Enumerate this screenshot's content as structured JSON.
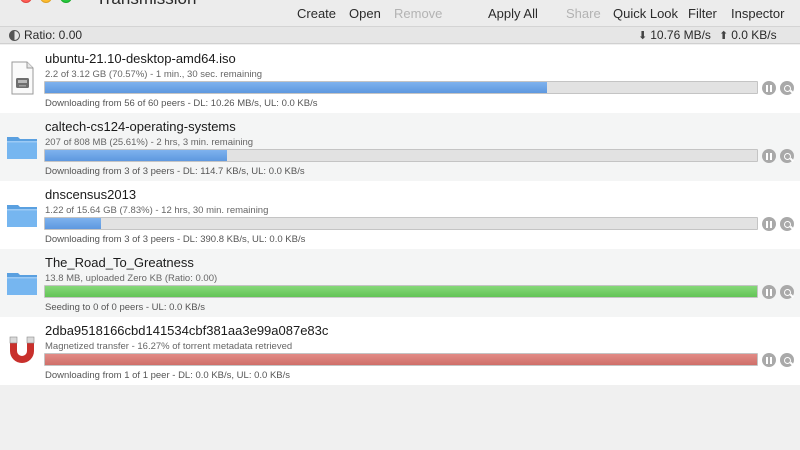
{
  "window": {
    "title": "Transmission"
  },
  "toolbar": {
    "create": "Create",
    "open": "Open",
    "remove": "Remove",
    "apply_all": "Apply All",
    "share": "Share",
    "quick_look": "Quick Look",
    "filter": "Filter",
    "inspector": "Inspector"
  },
  "statusbar": {
    "ratio": "Ratio: 0.00",
    "download_rate": "10.76 MB/s",
    "upload_rate": "0.0 KB/s"
  },
  "torrents": [
    {
      "name": "ubuntu-21.10-desktop-amd64.iso",
      "progress_text": "2.2 of 3.12 GB (70.57%) - 1 min., 30 sec. remaining",
      "status_text": "Downloading from 56 of 60 peers - DL: 10.26 MB/s, UL: 0.0 KB/s",
      "progress": 0.7057,
      "state": "downloading",
      "icon": "disk-image-icon",
      "bar_color": "#6aa3e6"
    },
    {
      "name": "caltech-cs124-operating-systems",
      "progress_text": "207 of 808 MB (25.61%) - 2 hrs, 3 min. remaining",
      "status_text": "Downloading from 3 of 3 peers - DL: 114.7 KB/s, UL: 0.0 KB/s",
      "progress": 0.2561,
      "state": "downloading",
      "icon": "folder-icon",
      "bar_color": "#6aa3e6"
    },
    {
      "name": "dnscensus2013",
      "progress_text": "1.22 of 15.64 GB (7.83%) - 12 hrs, 30 min. remaining",
      "status_text": "Downloading from 3 of 3 peers - DL: 390.8 KB/s, UL: 0.0 KB/s",
      "progress": 0.0783,
      "state": "downloading",
      "icon": "folder-icon",
      "bar_color": "#6aa3e6"
    },
    {
      "name": "The_Road_To_Greatness",
      "progress_text": "13.8 MB, uploaded Zero KB (Ratio: 0.00)",
      "status_text": "Seeding to 0 of 0 peers - UL: 0.0 KB/s",
      "progress": 1.0,
      "state": "seeding",
      "icon": "folder-icon",
      "bar_color": "#6dcc60"
    },
    {
      "name": "2dba9518166cbd141534cbf381aa3e99a087e83c",
      "progress_text": "Magnetized transfer - 16.27% of torrent metadata retrieved",
      "status_text": "Downloading from 1 of 1 peer - DL: 0.0 KB/s, UL: 0.0 KB/s",
      "progress": 1.0,
      "state": "magnet",
      "icon": "magnet-icon",
      "bar_color": "#d77a74"
    }
  ]
}
